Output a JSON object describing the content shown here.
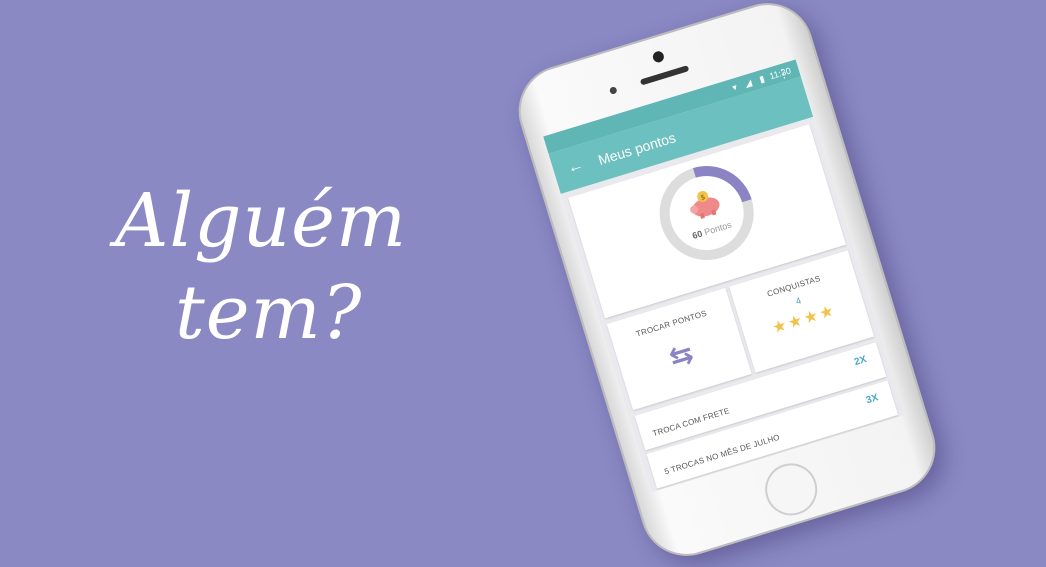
{
  "headline": {
    "line1": "Alguém",
    "line2": "tem?"
  },
  "statusbar": {
    "time": "11:30",
    "icons": "▾ ◢ ▮"
  },
  "appbar": {
    "title": "Meus pontos"
  },
  "points": {
    "value": "60",
    "unit": "Pontos",
    "progress_fraction": 0.25
  },
  "cards": {
    "trade_label": "TROCAR PONTOS",
    "achievements_label": "CONQUISTAS",
    "achievements_count": "4",
    "stars": "★★★★"
  },
  "list": [
    {
      "label": "TROCA COM FRETE",
      "multiplier": "2X"
    },
    {
      "label": "5 TROCAS NO MÊS DE JULHO",
      "multiplier": "3X"
    }
  ],
  "colors": {
    "background": "#8a89c4",
    "appbar": "#6cc0bf",
    "accent": "#8b83c4",
    "highlight": "#4aa8c9"
  }
}
